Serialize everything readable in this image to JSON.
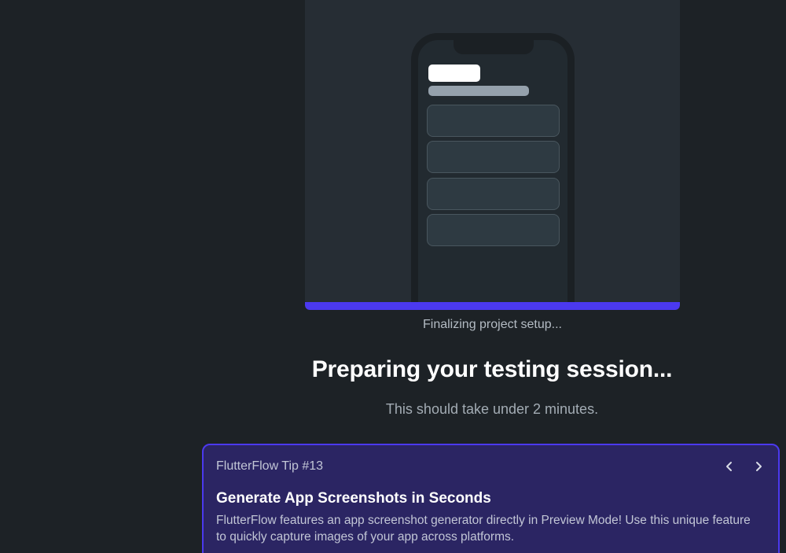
{
  "progress": {
    "fraction": 1.0,
    "status": "Finalizing project setup..."
  },
  "headline": "Preparing your testing session...",
  "subline": "This should take under 2 minutes.",
  "tip": {
    "label": "FlutterFlow Tip #13",
    "title": "Generate App Screenshots in Seconds",
    "body": "FlutterFlow features an app screenshot generator directly in Preview Mode! Use this unique feature to quickly capture images of your app across platforms.",
    "prev_icon": "chevron-left-icon",
    "next_icon": "chevron-right-icon"
  },
  "colors": {
    "background": "#1d2226",
    "accent": "#4b39ef",
    "tip_background": "#2b2563"
  }
}
